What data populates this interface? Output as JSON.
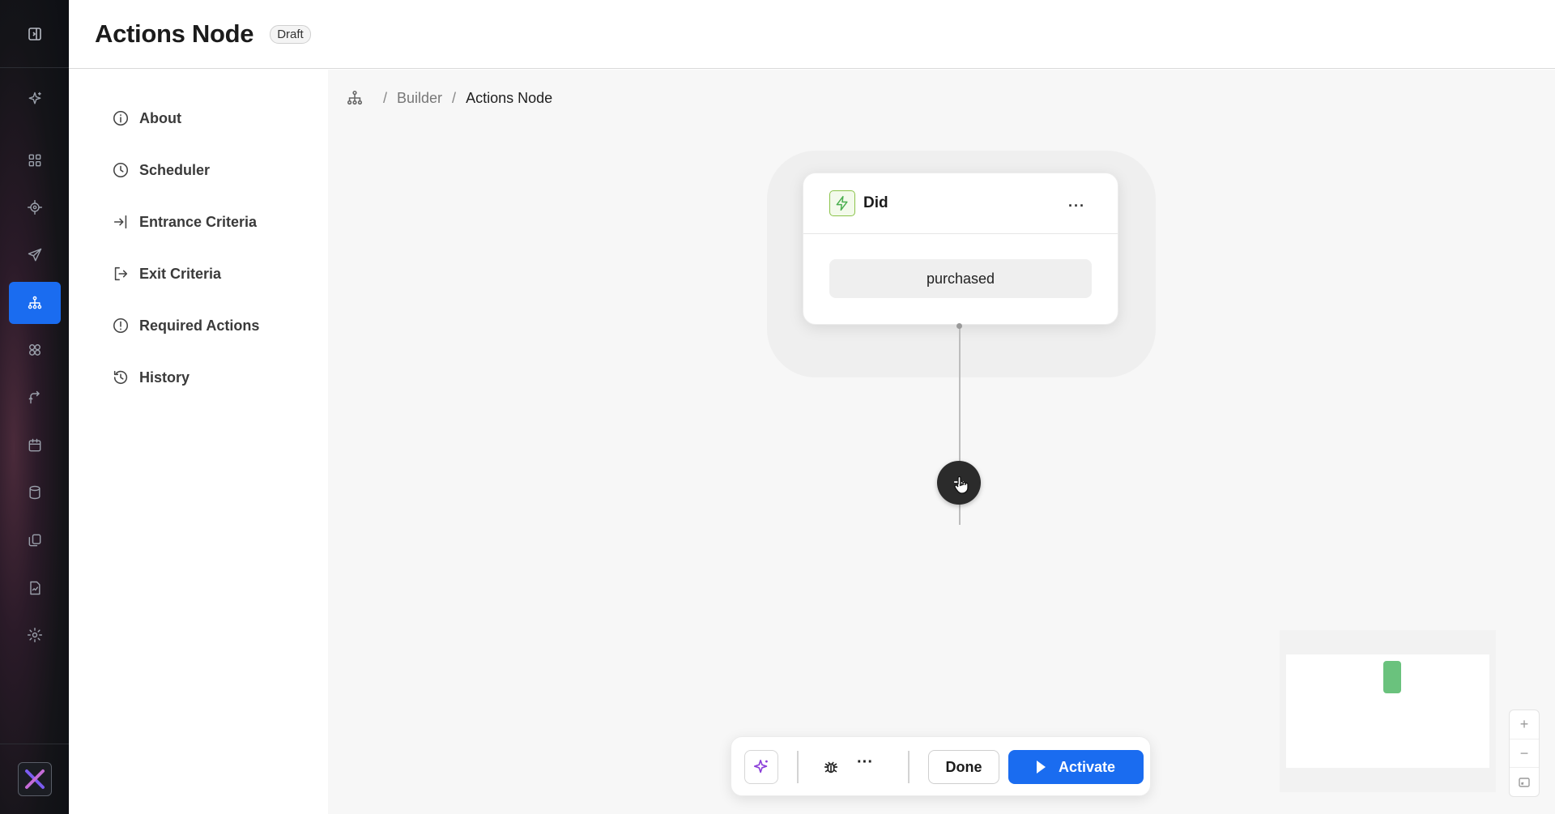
{
  "header": {
    "title": "Actions Node",
    "badge": "Draft"
  },
  "rail": {
    "items": [
      {
        "icon": "sparkle-icon"
      },
      {
        "icon": "grid-icon"
      },
      {
        "icon": "target-icon"
      },
      {
        "icon": "send-icon"
      },
      {
        "icon": "flow-icon",
        "active": true
      },
      {
        "icon": "apps-icon"
      },
      {
        "icon": "journey-icon"
      },
      {
        "icon": "calendar-icon"
      },
      {
        "icon": "database-icon"
      },
      {
        "icon": "copy-icon"
      },
      {
        "icon": "report-icon"
      },
      {
        "icon": "settings-icon"
      }
    ]
  },
  "menu": {
    "items": [
      {
        "label": "About",
        "icon": "info-icon"
      },
      {
        "label": "Scheduler",
        "icon": "clock-icon"
      },
      {
        "label": "Entrance Criteria",
        "icon": "enter-icon"
      },
      {
        "label": "Exit Criteria",
        "icon": "exit-icon"
      },
      {
        "label": "Required Actions",
        "icon": "alert-icon"
      },
      {
        "label": "History",
        "icon": "history-icon"
      }
    ]
  },
  "breadcrumb": {
    "root": "Builder",
    "current": "Actions Node",
    "separator": "/"
  },
  "node": {
    "title": "Did",
    "more": "···",
    "value": "purchased"
  },
  "canvas": {
    "add_label": "+"
  },
  "zoom": {
    "in": "+",
    "out": "−"
  },
  "toolbar": {
    "more": "···",
    "done": "Done",
    "activate": "Activate"
  },
  "colors": {
    "primary": "#1a6cf0",
    "node_icon": "#4caf50",
    "minimap_node": "#6ac27d"
  }
}
